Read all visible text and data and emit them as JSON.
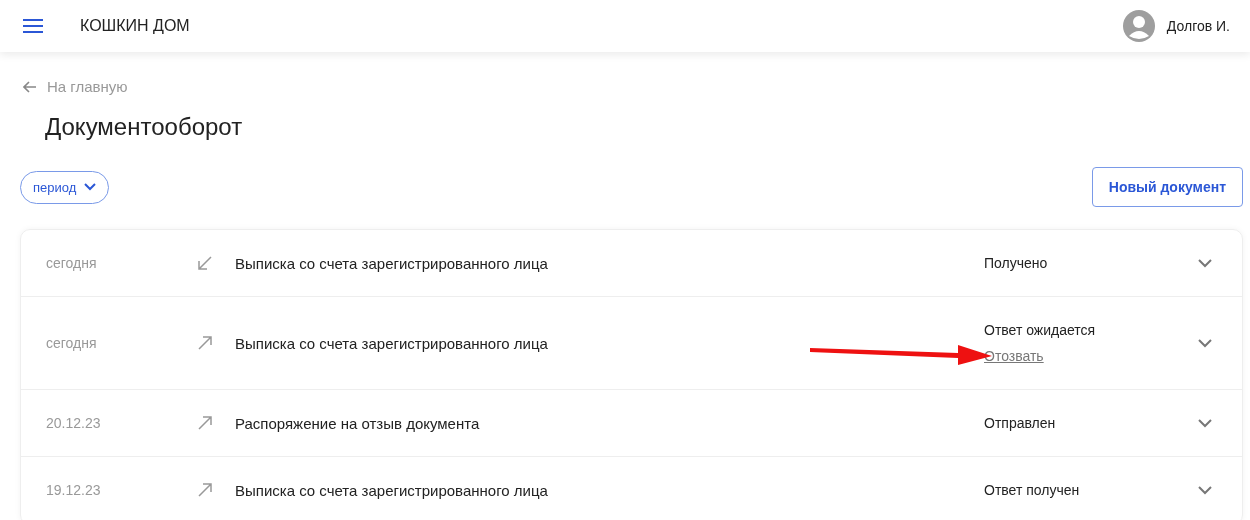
{
  "header": {
    "brand": "КОШКИН ДОМ",
    "user": "Долгов И."
  },
  "back_link": "На главную",
  "page_title": "Документооборот",
  "filter": {
    "label": "период"
  },
  "new_button": "Новый документ",
  "documents": [
    {
      "date": "сегодня",
      "kind": "incoming",
      "title": "Выписка со счета зарегистрированного лица",
      "status": "Получено",
      "expanded": false
    },
    {
      "date": "сегодня",
      "kind": "outgoing",
      "title": "Выписка со счета зарегистрированного лица",
      "status": "Ответ ожидается",
      "action": "Отозвать",
      "expanded": false
    },
    {
      "date": "20.12.23",
      "kind": "outgoing",
      "title": "Распоряжение на отзыв документа",
      "status": "Отправлен",
      "expanded": false
    },
    {
      "date": "19.12.23",
      "kind": "outgoing",
      "title": "Выписка со счета зарегистрированного лица",
      "status": "Ответ получен",
      "expanded": false
    }
  ]
}
